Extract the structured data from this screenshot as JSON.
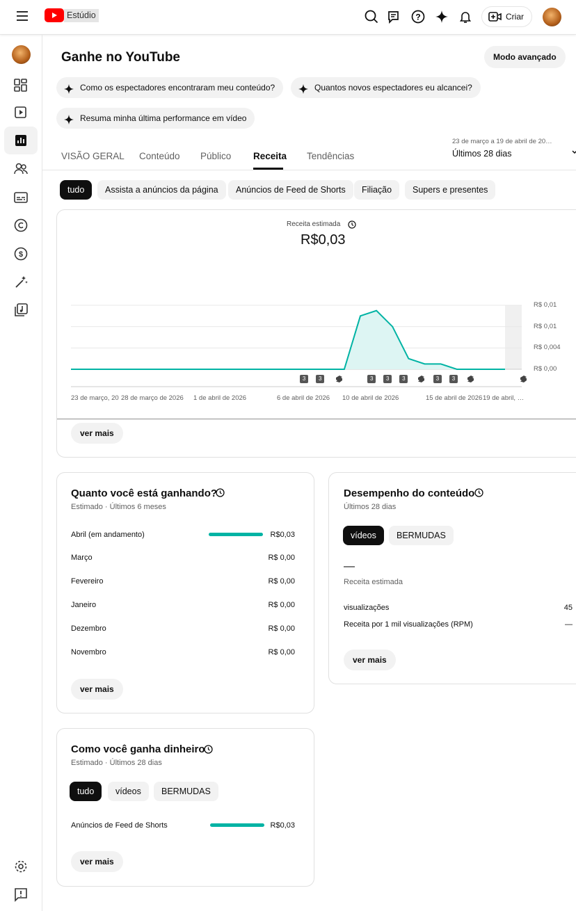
{
  "topbar": {
    "logo_text": "Estúdio",
    "create_label": "Criar"
  },
  "header": {
    "title": "Ganhe no YouTube",
    "advanced_mode": "Modo avançado"
  },
  "suggestions": [
    "Como os espectadores encontraram meu conteúdo?",
    "Quantos novos espectadores eu alcancei?",
    "Resuma minha última performance em vídeo"
  ],
  "tabs": [
    "VISÃO GERAL",
    "Conteúdo",
    "Público",
    "Receita",
    "Tendências"
  ],
  "active_tab": "Receita",
  "date_range": {
    "range": "23 de março a 19 de abril de 20…",
    "label": "Últimos 28 dias"
  },
  "filters": [
    "tudo",
    "Assista a anúncios da página",
    "Anúncios de Feed de Shorts",
    "Filiação",
    "Supers e presentes"
  ],
  "revenue_card": {
    "metric_label": "Receita estimada",
    "metric_value": "R$0,03",
    "more": "ver mais"
  },
  "chart_data": {
    "type": "area",
    "title": "Receita estimada",
    "x_tick_labels": [
      "23 de março, 20",
      "28 de março de 2026",
      "1 de abril de 2026",
      "6 de abril de 2026",
      "10 de abril de 2026",
      "15 de abril de 2026",
      "19 de abril, …"
    ],
    "y_tick_labels": [
      "R$ 0,00",
      "R$ 0,004",
      "R$ 0,01",
      "R$ 0,01"
    ],
    "y_ticks": [
      0,
      0.004,
      0.008,
      0.012
    ],
    "ylim": [
      0,
      0.012
    ],
    "days": 28,
    "values": [
      0,
      0,
      0,
      0,
      0,
      0,
      0,
      0,
      0,
      0,
      0,
      0,
      0,
      0,
      0,
      0,
      0,
      0,
      0.01,
      0.011,
      0.008,
      0.002,
      0.001,
      0.001,
      0,
      0,
      0,
      0
    ],
    "markers": [
      {
        "day": 14.5,
        "type": "video",
        "label": "3"
      },
      {
        "day": 15.5,
        "type": "video",
        "label": "3"
      },
      {
        "day": 16.6,
        "type": "short"
      },
      {
        "day": 18.7,
        "type": "video",
        "label": "3"
      },
      {
        "day": 19.7,
        "type": "video",
        "label": "3"
      },
      {
        "day": 20.7,
        "type": "video",
        "label": "3"
      },
      {
        "day": 21.7,
        "type": "short"
      },
      {
        "day": 22.8,
        "type": "video",
        "label": "3"
      },
      {
        "day": 23.8,
        "type": "video",
        "label": "3"
      },
      {
        "day": 24.8,
        "type": "short"
      },
      {
        "day": 28.1,
        "type": "short"
      }
    ],
    "color": "#00b3a4"
  },
  "earnings": {
    "title": "Quanto você está ganhando?",
    "subtitle": "Estimado · Últimos 6 meses",
    "rows": [
      {
        "month": "Abril (em andamento)",
        "value": "R$0,03",
        "fraction": 1
      },
      {
        "month": "Março",
        "value": "R$ 0,00"
      },
      {
        "month": "Fevereiro",
        "value": "R$ 0,00"
      },
      {
        "month": "Janeiro",
        "value": "R$ 0,00"
      },
      {
        "month": "Dezembro",
        "value": "R$ 0,00"
      },
      {
        "month": "Novembro",
        "value": "R$ 0,00"
      }
    ],
    "more": "ver mais"
  },
  "content": {
    "title": "Desempenho do conteúdo",
    "subtitle": "Últimos 28 dias",
    "chips": [
      "vídeos",
      "BERMUDAS"
    ],
    "value": "—",
    "value_label": "Receita estimada",
    "stats": [
      {
        "label": "visualizações",
        "value": "45"
      },
      {
        "label": "Receita por 1 mil visualizações (RPM)",
        "value": "—"
      }
    ],
    "more": "ver mais"
  },
  "how": {
    "title": "Como você ganha dinheiro",
    "subtitle": "Estimado · Últimos 28 dias",
    "chips": [
      "tudo",
      "vídeos",
      "BERMUDAS"
    ],
    "rows": [
      {
        "label": "Anúncios de Feed de Shorts",
        "value": "R$0,03",
        "fraction": 1
      }
    ],
    "more": "ver mais"
  }
}
